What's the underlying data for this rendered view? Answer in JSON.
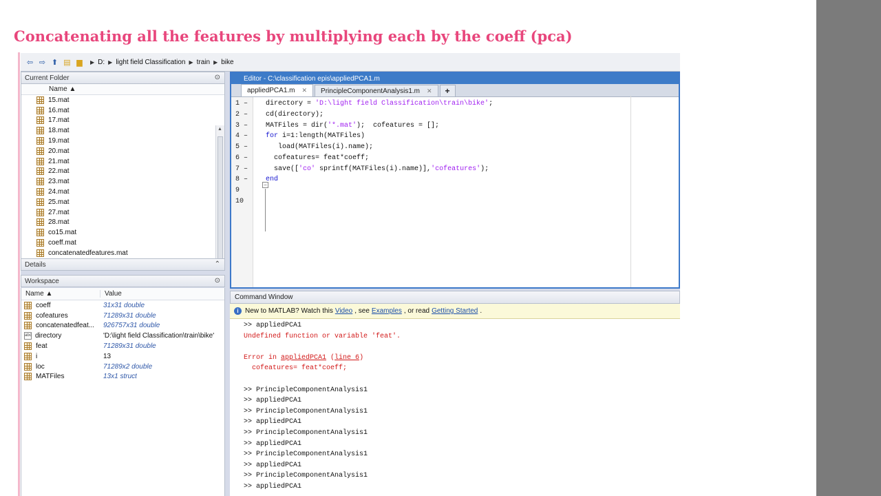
{
  "slide": {
    "title": "Concatenating all the features by multiplying each by the coeff (pca)"
  },
  "address": {
    "crumbs": [
      "D:",
      "light field Classification",
      "train",
      "bike"
    ]
  },
  "current_folder": {
    "title": "Current Folder",
    "column": "Name ▲",
    "files": [
      "15.mat",
      "16.mat",
      "17.mat",
      "18.mat",
      "19.mat",
      "20.mat",
      "21.mat",
      "22.mat",
      "23.mat",
      "24.mat",
      "25.mat",
      "27.mat",
      "28.mat",
      "co15.mat",
      "coeff.mat",
      "concatenatedfeatures.mat"
    ]
  },
  "details": {
    "title": "Details"
  },
  "workspace": {
    "title": "Workspace",
    "col_name": "Name ▲",
    "col_value": "Value",
    "vars": [
      {
        "name": "coeff",
        "value": "31x31 double",
        "icon": "matrix-icon"
      },
      {
        "name": "cofeatures",
        "value": "71289x31 double",
        "icon": "matrix-icon"
      },
      {
        "name": "concatenatedfeat...",
        "value": "926757x31 double",
        "icon": "matrix-icon"
      },
      {
        "name": "directory",
        "value": "'D:\\light field Classification\\train\\bike'",
        "icon": "char-icon"
      },
      {
        "name": "feat",
        "value": "71289x31 double",
        "icon": "matrix-icon"
      },
      {
        "name": "i",
        "value": "13",
        "icon": "matrix-icon"
      },
      {
        "name": "loc",
        "value": "71289x2 double",
        "icon": "matrix-icon"
      },
      {
        "name": "MATFiles",
        "value": "13x1 struct",
        "icon": "struct-icon"
      }
    ]
  },
  "editor": {
    "title": "Editor - C:\\classification epis\\appliedPCA1.m",
    "tabs": [
      {
        "label": "appliedPCA1.m",
        "active": true
      },
      {
        "label": "PrincipleComponentAnalysis1.m",
        "active": false
      }
    ],
    "plus": "+",
    "line_numbers": [
      "1 –",
      "2 –",
      "3 –",
      "4 –",
      "5 –",
      "6 –",
      "7 –",
      "8 –",
      "9",
      "10"
    ],
    "lines": [
      {
        "indent": 3,
        "parts": [
          {
            "t": "directory = ",
            "c": ""
          },
          {
            "t": "'D:\\light field Classification\\train\\bike'",
            "c": "str"
          },
          {
            "t": ";",
            "c": ""
          }
        ]
      },
      {
        "indent": 3,
        "parts": [
          {
            "t": "cd(directory);",
            "c": ""
          }
        ]
      },
      {
        "indent": 3,
        "parts": [
          {
            "t": "MATFiles = dir(",
            "c": ""
          },
          {
            "t": "'*.mat'",
            "c": "str"
          },
          {
            "t": ");  cofeatures = [];",
            "c": ""
          }
        ]
      },
      {
        "indent": 3,
        "parts": [
          {
            "t": "for",
            "c": "kw"
          },
          {
            "t": " i=1:length(MATFiles)",
            "c": ""
          }
        ]
      },
      {
        "indent": 6,
        "parts": [
          {
            "t": "load(MATFiles(i).name);",
            "c": ""
          }
        ]
      },
      {
        "indent": 5,
        "parts": [
          {
            "t": "cofeatures= feat*coeff;",
            "c": ""
          }
        ]
      },
      {
        "indent": 5,
        "parts": [
          {
            "t": "save([",
            "c": ""
          },
          {
            "t": "'co'",
            "c": "str"
          },
          {
            "t": " sprintf(MATFiles(i).name)],",
            "c": ""
          },
          {
            "t": "'cofeatures'",
            "c": "str"
          },
          {
            "t": ");",
            "c": ""
          }
        ]
      },
      {
        "indent": 3,
        "parts": [
          {
            "t": "end",
            "c": "kw"
          }
        ]
      }
    ]
  },
  "command_window": {
    "title": "Command Window",
    "notice": {
      "prefix": "New to MATLAB? Watch this",
      "video": "Video",
      "see": ", see",
      "examples": "Examples",
      "or_read": ", or read",
      "getting_started": "Getting Started",
      "end": "."
    },
    "lines": [
      {
        "text": ">> appliedPCA1",
        "kind": "normal"
      },
      {
        "text": "Undefined function or variable 'feat'.",
        "kind": "error"
      },
      {
        "text": "",
        "kind": "blank"
      },
      {
        "text": "Error in ",
        "kind": "error-in",
        "link1": "appliedPCA1",
        "mid": " (",
        "link2": "line 6",
        "close": ")"
      },
      {
        "text": "  cofeatures= feat*coeff;",
        "kind": "error"
      },
      {
        "text": "",
        "kind": "blank"
      },
      {
        "text": ">> PrincipleComponentAnalysis1",
        "kind": "normal"
      },
      {
        "text": ">> appliedPCA1",
        "kind": "normal"
      },
      {
        "text": ">> PrincipleComponentAnalysis1",
        "kind": "normal"
      },
      {
        "text": ">> appliedPCA1",
        "kind": "normal"
      },
      {
        "text": ">> PrincipleComponentAnalysis1",
        "kind": "normal"
      },
      {
        "text": ">> appliedPCA1",
        "kind": "normal"
      },
      {
        "text": ">> PrincipleComponentAnalysis1",
        "kind": "normal"
      },
      {
        "text": ">> appliedPCA1",
        "kind": "normal"
      },
      {
        "text": ">> PrincipleComponentAnalysis1",
        "kind": "normal"
      },
      {
        "text": ">> appliedPCA1",
        "kind": "normal"
      }
    ]
  }
}
